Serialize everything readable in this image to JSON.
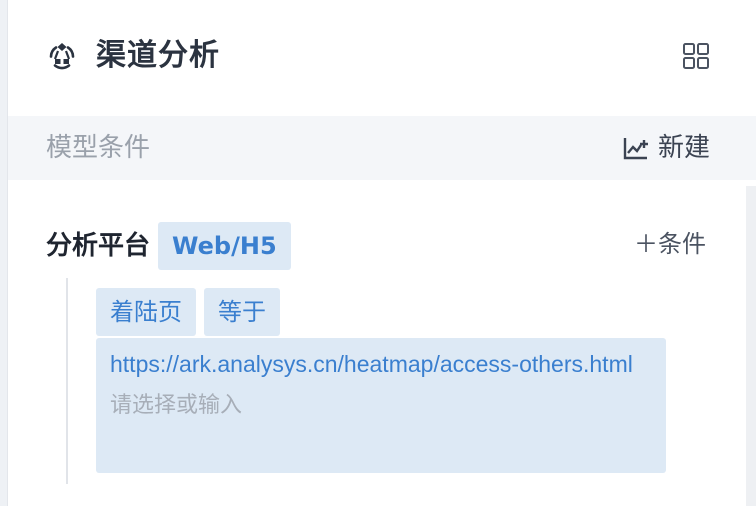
{
  "header": {
    "title": "渠道分析",
    "icon": "funnel-channel-icon",
    "grid_icon": "grid-icon"
  },
  "model_bar": {
    "label": "模型条件",
    "new_label": "新建",
    "new_icon": "chart-new-icon"
  },
  "condition": {
    "platform_label": "分析平台",
    "platform_value": "Web/H5",
    "add_condition_label": "＋条件",
    "field_chip": "着陆页",
    "operator_chip": "等于",
    "value_text": "https://ark.analysys.cn/heatmap/access-others.html",
    "input_placeholder": "请选择或输入",
    "input_value": ""
  },
  "colors": {
    "accent": "#3a7fcf",
    "chip_bg": "#dde9f5",
    "bar_bg": "#f4f6f9",
    "title": "#2b3340"
  }
}
